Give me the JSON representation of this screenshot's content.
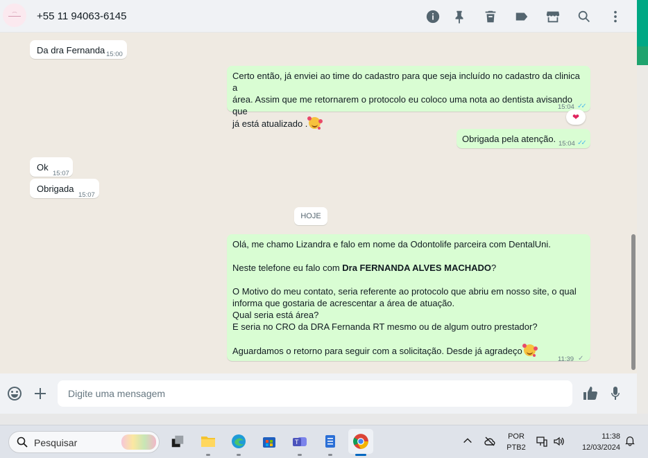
{
  "header": {
    "contact_name": "+55 11 94063-6145",
    "icons": [
      "info-icon",
      "pin-icon",
      "delete-icon",
      "label-icon",
      "store-icon",
      "search-icon",
      "more-icon"
    ]
  },
  "messages": [
    {
      "direction": "in",
      "text": "Da dra Fernanda",
      "time": "15:00"
    },
    {
      "direction": "out",
      "lines": [
        "Certo então, já enviei ao time do cadastro para que seja incluído no cadastro da clinica a",
        "área. Assim que me retornarem o protocolo eu coloco uma nota ao dentista avisando que",
        "já está atualizado ."
      ],
      "time": "15:04",
      "status": "read",
      "reaction": "heart"
    },
    {
      "direction": "out",
      "text": "Obrigada pela atenção.",
      "time": "15:04",
      "status": "read"
    },
    {
      "direction": "in",
      "text": "Ok",
      "time": "15:07"
    },
    {
      "direction": "in",
      "text": "Obrigada",
      "time": "15:07"
    }
  ],
  "day_separator": "HOJE",
  "last_message": {
    "line1": "Olá, me chamo Lizandra e falo em nome da Odontolife parceira com DentalUni.",
    "line2_prefix": "Neste telefone eu falo com ",
    "line2_bold": "Dra FERNANDA ALVES MACHADO",
    "line2_suffix": "?",
    "line3": "O Motivo do meu contato, seria referente ao protocolo que abriu em nosso site, o qual",
    "line4": "informa que gostaria de acrescentar a área de atuação.",
    "line5": "Qual seria está área?",
    "line6": "E seria no CRO da DRA Fernanda RT mesmo ou de algum outro prestador?",
    "line7": "Aguardamos o retorno para seguir com a solicitação. Desde já agradeço",
    "time": "11:39",
    "status": "sent"
  },
  "compose": {
    "placeholder": "Digite uma mensagem"
  },
  "taskbar": {
    "search_label": "Pesquisar",
    "lang_top": "POR",
    "lang_bottom": "PTB2",
    "time": "11:38",
    "date": "12/03/2024"
  },
  "colors": {
    "incoming": "#ffffff",
    "outgoing": "#d9fdd3",
    "accent": "#00a884",
    "read_ticks": "#53bdeb"
  }
}
